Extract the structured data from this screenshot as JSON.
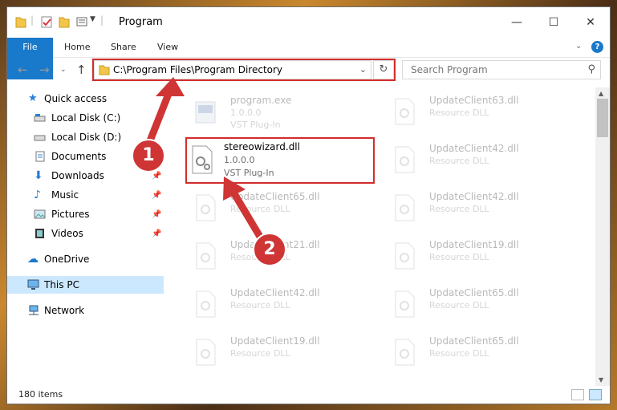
{
  "window": {
    "title": "Program"
  },
  "ribbon": {
    "tabs": [
      "File",
      "Home",
      "Share",
      "View"
    ]
  },
  "address": {
    "path": "C:\\Program Files\\Program Directory"
  },
  "search": {
    "placeholder": "Search Program"
  },
  "nav": {
    "quick_access": "Quick access",
    "items": [
      "Local Disk (C:)",
      "Local Disk (D:)",
      "Documents",
      "Downloads",
      "Music",
      "Pictures",
      "Videos"
    ],
    "onedrive": "OneDrive",
    "this_pc": "This PC",
    "network": "Network"
  },
  "files": [
    {
      "name": "program.exe",
      "version": "1.0.0.0",
      "type": "VST Plug-In"
    },
    {
      "name": "stereowizard.dll",
      "version": "1.0.0.0",
      "type": "VST Plug-In"
    },
    {
      "name": "UpdateClient65.dll",
      "type": "Resource DLL"
    },
    {
      "name": "UpdateClient21.dll",
      "type": "Resource DLL"
    },
    {
      "name": "UpdateClient42.dll",
      "type": "Resource DLL"
    },
    {
      "name": "UpdateClient19.dll",
      "type": "Resource DLL"
    },
    {
      "name": "UpdateClient63.dll",
      "type": "Resource DLL"
    },
    {
      "name": "UpdateClient42.dll",
      "type": "Resource DLL"
    },
    {
      "name": "UpdateClient42.dll",
      "type": "Resource DLL"
    },
    {
      "name": "UpdateClient19.dll",
      "type": "Resource DLL"
    },
    {
      "name": "UpdateClient65.dll",
      "type": "Resource DLL"
    },
    {
      "name": "UpdateClient65.dll",
      "type": "Resource DLL"
    }
  ],
  "status": {
    "count": "180 items"
  },
  "badges": [
    "1",
    "2"
  ],
  "colors": {
    "accent": "#1979ca",
    "highlight": "#d32d2d",
    "selected": "#cce8ff"
  }
}
